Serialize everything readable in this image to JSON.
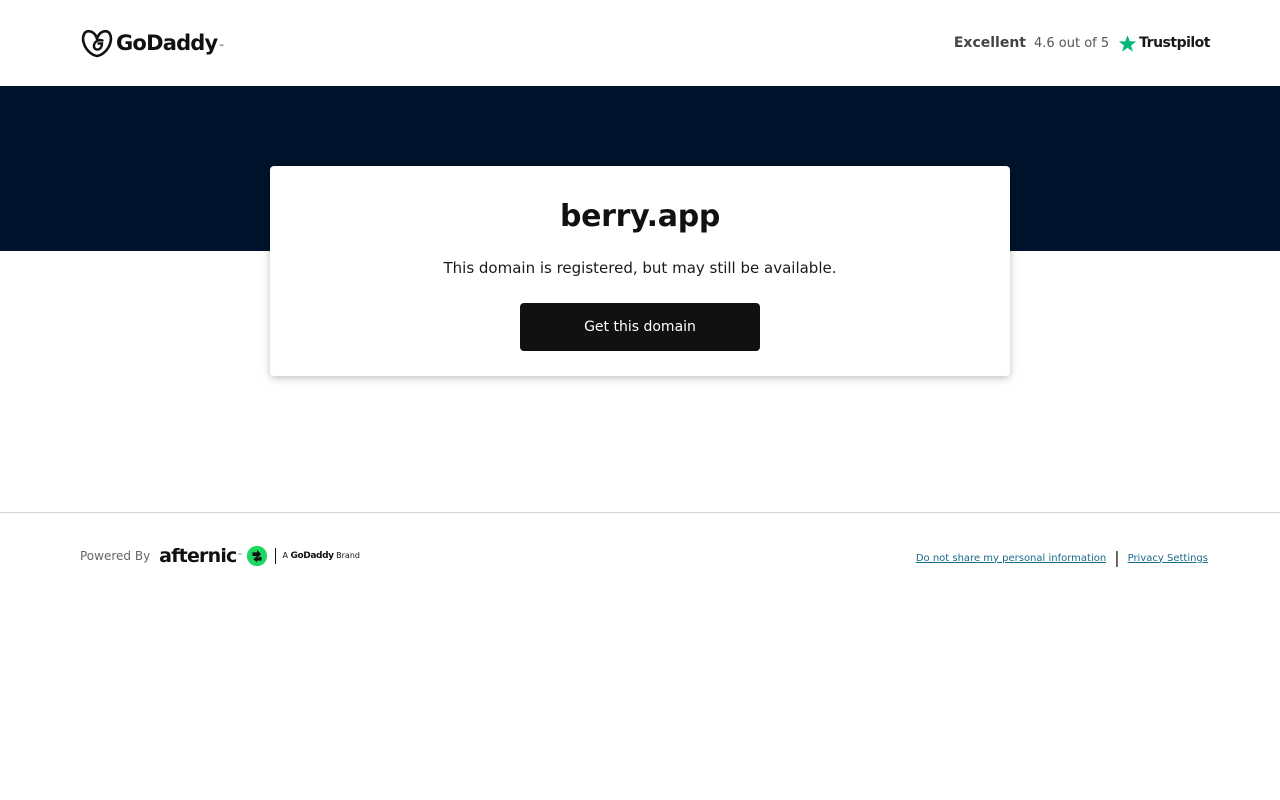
{
  "header": {
    "brand": "GoDaddy",
    "brand_tm": "™",
    "rating_word": "Excellent",
    "rating_score": "4.6 out of 5",
    "rating_provider": "Trustpilot"
  },
  "card": {
    "domain": "berry.app",
    "subtitle": "This domain is registered, but may still be available.",
    "cta_label": "Get this domain"
  },
  "footer": {
    "powered_by": "Powered By",
    "partner_brand": "afternic",
    "partner_tm": "™",
    "brand_tag_prefix": "A",
    "brand_tag_name": "GoDaddy",
    "brand_tag_suffix": "Brand",
    "links": [
      "Do not share my personal information",
      "Privacy Settings"
    ],
    "link_separator": "|"
  },
  "colors": {
    "hero_bg": "#00132c",
    "cta_bg": "#111111",
    "trustpilot_green": "#00b67a",
    "afternic_green": "#1ed760",
    "link": "#1a6a8a"
  },
  "icons": [
    "godaddy-logo-icon",
    "trustpilot-star-icon",
    "afternic-icon"
  ]
}
